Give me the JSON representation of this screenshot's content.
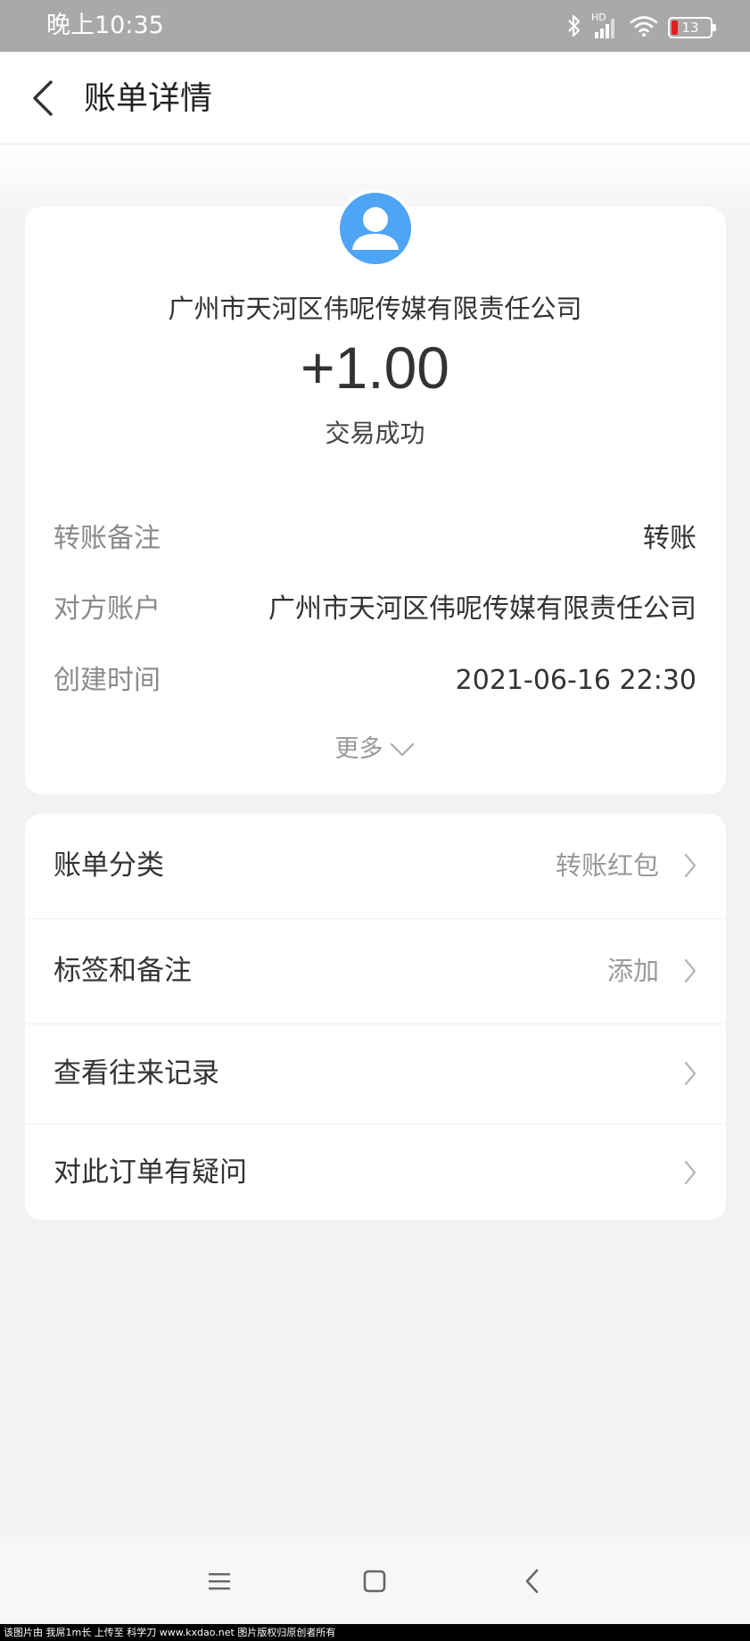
{
  "status_bar": {
    "time": "晚上10:35",
    "network_label": "HD",
    "battery_level": "13",
    "battery_color": "#e02020"
  },
  "nav": {
    "back_icon": "chevron-left-icon",
    "title": "账单详情"
  },
  "summary": {
    "avatar_icon": "person-icon",
    "avatar_color": "#4ea4f5",
    "counterparty": "广州市天河区伟呢传媒有限责任公司",
    "amount": "+1.00",
    "status": "交易成功"
  },
  "details": [
    {
      "label": "转账备注",
      "value": "转账"
    },
    {
      "label": "对方账户",
      "value": "广州市天河区伟呢传媒有限责任公司"
    },
    {
      "label": "创建时间",
      "value": "2021-06-16 22:30"
    }
  ],
  "more_label": "更多",
  "menu": [
    {
      "label": "账单分类",
      "value": "转账红包"
    },
    {
      "label": "标签和备注",
      "value": "添加"
    },
    {
      "label": "查看往来记录",
      "value": ""
    },
    {
      "label": "对此订单有疑问",
      "value": ""
    }
  ],
  "system_nav": [
    "menu-icon",
    "home-icon",
    "back-icon"
  ],
  "watermark": "该图片由 我屌1m长 上传至 科学刀 www.kxdao.net 图片版权归原创者所有"
}
